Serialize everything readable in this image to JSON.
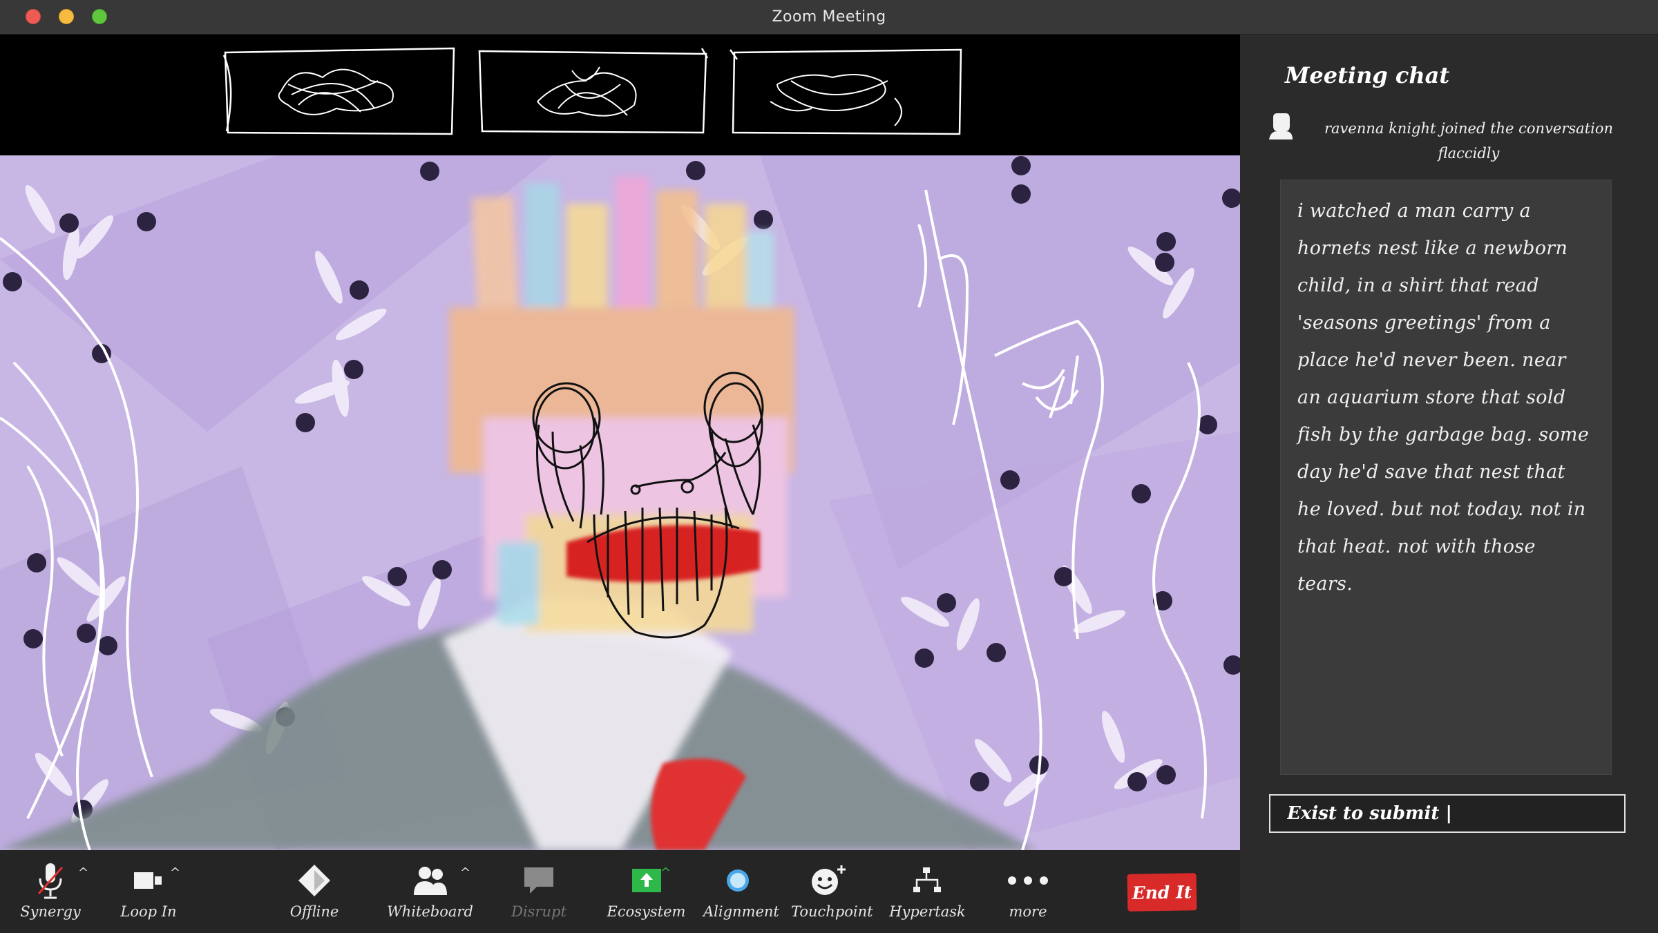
{
  "window": {
    "title": "Zoom Meeting"
  },
  "thumbnails": [
    {
      "name": "participant-thumb-1"
    },
    {
      "name": "participant-thumb-2"
    },
    {
      "name": "participant-thumb-3"
    }
  ],
  "toolbar": {
    "synergy": "Synergy",
    "loop_in": "Loop In",
    "offline": "Offline",
    "whiteboard": "Whiteboard",
    "disrupt": "Disrupt",
    "ecosystem": "Ecosystem",
    "alignment": "Alignment",
    "touchpoint": "Touchpoint",
    "hypertask": "Hypertask",
    "more": "more",
    "end": "End It",
    "caret": "^"
  },
  "chat": {
    "title": "Meeting chat",
    "join_notice": "ravenna knight joined the conversation flaccidly",
    "message": "i watched a man carry a hornets nest like a newborn child, in a shirt that read 'seasons greetings' from a place he'd never been. near an aquarium store that sold fish by the garbage bag. some day he'd save that nest that he loved. but not today. not in that heat. not with those tears.",
    "input_placeholder": "Exist to submit |"
  },
  "colors": {
    "accent_red": "#d92a2a",
    "video_bg": "#c9b7e6",
    "ecosystem_green": "#2fb84a",
    "alignment_blue": "#4aa8e8"
  }
}
